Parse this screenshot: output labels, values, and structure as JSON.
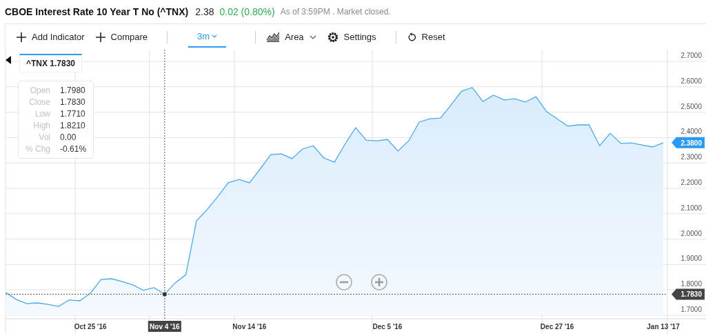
{
  "quote": {
    "title": "CBOE Interest Rate 10 Year T No (^TNX)",
    "price": "2.38",
    "change": "0.02 (0.80%)",
    "status": "As of 3:59PM . Market closed."
  },
  "toolbar": [
    {
      "kind": "plus",
      "label": "Add Indicator"
    },
    {
      "kind": "plus",
      "label": "Compare"
    },
    {
      "kind": "divider"
    },
    {
      "kind": "range",
      "label": "3m",
      "selected": true
    },
    {
      "kind": "divider"
    },
    {
      "kind": "chart-type",
      "label": "Area"
    },
    {
      "kind": "settings",
      "label": "Settings"
    },
    {
      "kind": "divider"
    },
    {
      "kind": "reset",
      "label": "Reset"
    }
  ],
  "series_tag": {
    "value": "1.7830"
  },
  "axis_tags": [
    {
      "kind": "last",
      "label": "2.3800"
    },
    {
      "kind": "crosshair",
      "label": "1.7830"
    }
  ],
  "tooltip": [
    {
      "label": "Open",
      "value": "1.7980"
    },
    {
      "label": "Close",
      "value": "1.7830"
    },
    {
      "label": "Low",
      "value": "1.7710"
    },
    {
      "label": "High",
      "value": "1.8210"
    },
    {
      "label": "Vol",
      "value": "0.00"
    },
    {
      "label": "% Chg",
      "value": "-0.61%"
    }
  ],
  "chart_data": {
    "type": "area",
    "categories": [
      null,
      null,
      null,
      null,
      null,
      null,
      null,
      null,
      "Oct 25 '16",
      null,
      null,
      null,
      null,
      null,
      null,
      "Nov 4 '16",
      null,
      null,
      null,
      null,
      null,
      null,
      null,
      "Nov 14 '16",
      null,
      null,
      null,
      null,
      null,
      null,
      null,
      null,
      null,
      null,
      null,
      null,
      "Dec 5 '16",
      null,
      null,
      null,
      null,
      null,
      null,
      null,
      null,
      null,
      null,
      null,
      null,
      null,
      null,
      null,
      "Dec 27 '16",
      null,
      null,
      null,
      null,
      null,
      null,
      null,
      null,
      null,
      "Jan 13 '17"
    ],
    "series": [
      {
        "name": "^TNX",
        "color": "#4aa8f0",
        "values": [
          1.79,
          1.763,
          1.746,
          1.749,
          1.743,
          1.735,
          1.76,
          1.757,
          1.787,
          1.841,
          1.844,
          1.833,
          1.82,
          1.798,
          1.809,
          1.783,
          1.828,
          1.86,
          2.072,
          2.116,
          2.167,
          2.222,
          2.235,
          2.222,
          2.276,
          2.333,
          2.336,
          2.317,
          2.355,
          2.368,
          2.32,
          2.303,
          2.374,
          2.439,
          2.39,
          2.387,
          2.393,
          2.347,
          2.387,
          2.461,
          2.474,
          2.477,
          2.529,
          2.583,
          2.597,
          2.542,
          2.567,
          2.548,
          2.553,
          2.54,
          2.561,
          2.502,
          2.474,
          2.445,
          2.45,
          2.45,
          2.368,
          2.417,
          2.377,
          2.379,
          2.371,
          2.363,
          2.38
        ]
      }
    ],
    "ylim": [
      1.7,
      2.7
    ],
    "yticks": [
      {
        "value": 2.7,
        "label": "2.7000"
      },
      {
        "value": 2.6,
        "label": "2.6000"
      },
      {
        "value": 2.5,
        "label": "2.5000"
      },
      {
        "value": 2.4,
        "label": "2.4000"
      },
      {
        "value": 2.3,
        "label": "2.3000"
      },
      {
        "value": 2.2,
        "label": "2.2000"
      },
      {
        "value": 2.1,
        "label": "2.1000"
      },
      {
        "value": 2.0,
        "label": "2.0000"
      },
      {
        "value": 1.9,
        "label": "1.9000"
      },
      {
        "value": 1.8,
        "label": "1.8000"
      },
      {
        "value": 1.7,
        "label": "1.7000"
      }
    ],
    "grid": true,
    "ref_lines": [
      {
        "axis": "y",
        "value": 1.783
      },
      {
        "axis": "x",
        "value": "Nov 4 '16"
      }
    ]
  }
}
